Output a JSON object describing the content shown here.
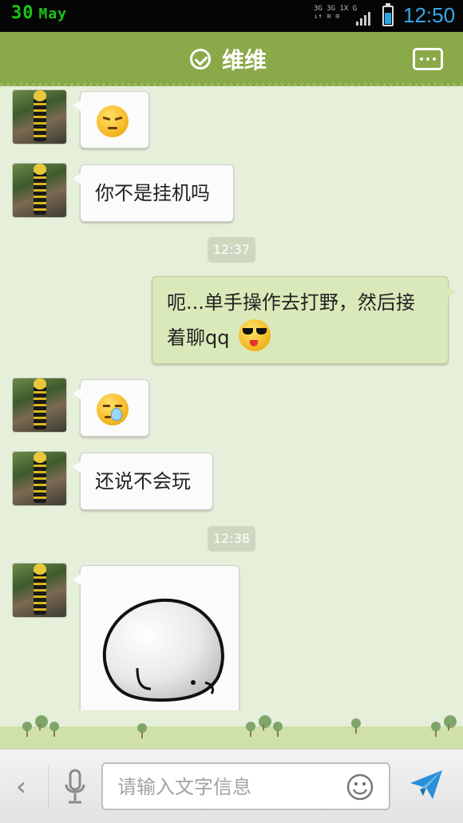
{
  "status_bar": {
    "date_day": "30",
    "date_month": "May",
    "network_line1": "3G 3G 1X G",
    "network_line2": "↓↑ ≡ ≡",
    "time": "12:50"
  },
  "header": {
    "title": "维维",
    "status_icon": "check-circle-icon",
    "menu_icon": "more-icon"
  },
  "messages": [
    {
      "direction": "in",
      "type": "emoji",
      "emoji": "annoyed-face-icon"
    },
    {
      "direction": "in",
      "type": "text",
      "text": "你不是挂机吗"
    },
    {
      "type": "time",
      "text": "12:37"
    },
    {
      "direction": "out",
      "type": "text",
      "line1": "呃...单手操作去打野，然后接",
      "line2": "着聊qq",
      "emoji": "sunglasses-face-icon"
    },
    {
      "direction": "in",
      "type": "emoji",
      "emoji": "crying-face-icon"
    },
    {
      "direction": "in",
      "type": "text",
      "text": "还说不会玩"
    },
    {
      "type": "time",
      "text": "12:38"
    },
    {
      "direction": "in",
      "type": "sticker",
      "sticker": "round-blob-sticker"
    }
  ],
  "input_bar": {
    "placeholder": "请输入文字信息",
    "back_icon": "chevron-left-icon",
    "mic_icon": "microphone-icon",
    "emoji_icon": "smiley-icon",
    "send_icon": "send-icon"
  },
  "colors": {
    "header": "#8aaa46",
    "chat_background": "#e6efd9",
    "outgoing_bubble": "#d9e9b9",
    "incoming_bubble": "#fbfbfb",
    "time_accent": "#36a8e6",
    "date_accent": "#19c619"
  }
}
